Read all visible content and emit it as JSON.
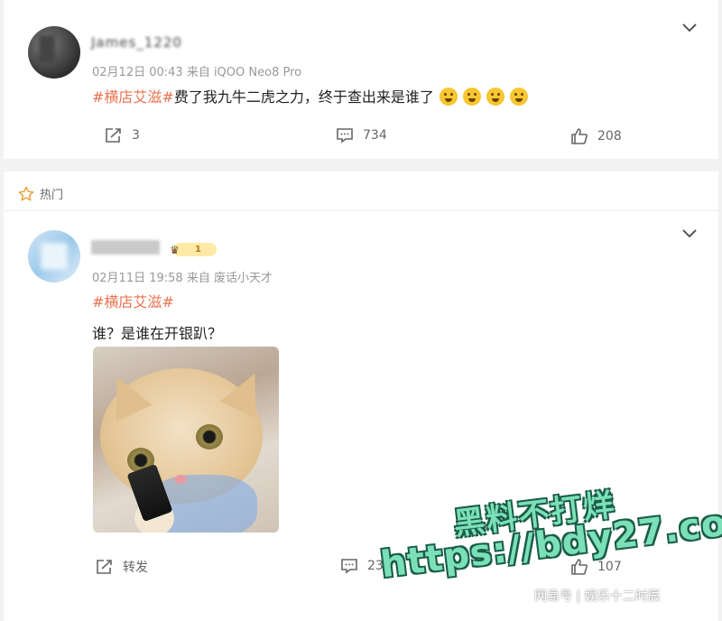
{
  "posts": [
    {
      "username": "James_1220",
      "meta": "02月12日 00:43  来自 iQOO Neo8 Pro",
      "hashtag": "#横店艾滋#",
      "text": "费了我九牛二虎之力，终于查出来是谁了",
      "emoji_count": 4,
      "actions": {
        "repost": "3",
        "comment": "734",
        "like": "208"
      }
    },
    {
      "section_label": "热门",
      "badge_level": "1",
      "meta": "02月11日 19:58  来自 废话小天才",
      "hashtag": "#横店艾滋#",
      "text": "谁？是谁在开银趴？",
      "actions": {
        "repost": "转发",
        "comment": "23",
        "like": "107"
      }
    }
  ],
  "watermark": {
    "line1": "黑料不打烊",
    "line2": "https://bdy27.co"
  },
  "footer_source": "网易号 | 娱乐十二时辰",
  "colors": {
    "accent": "#eb7350",
    "meta": "#999999",
    "background": "#f2f2f2"
  }
}
